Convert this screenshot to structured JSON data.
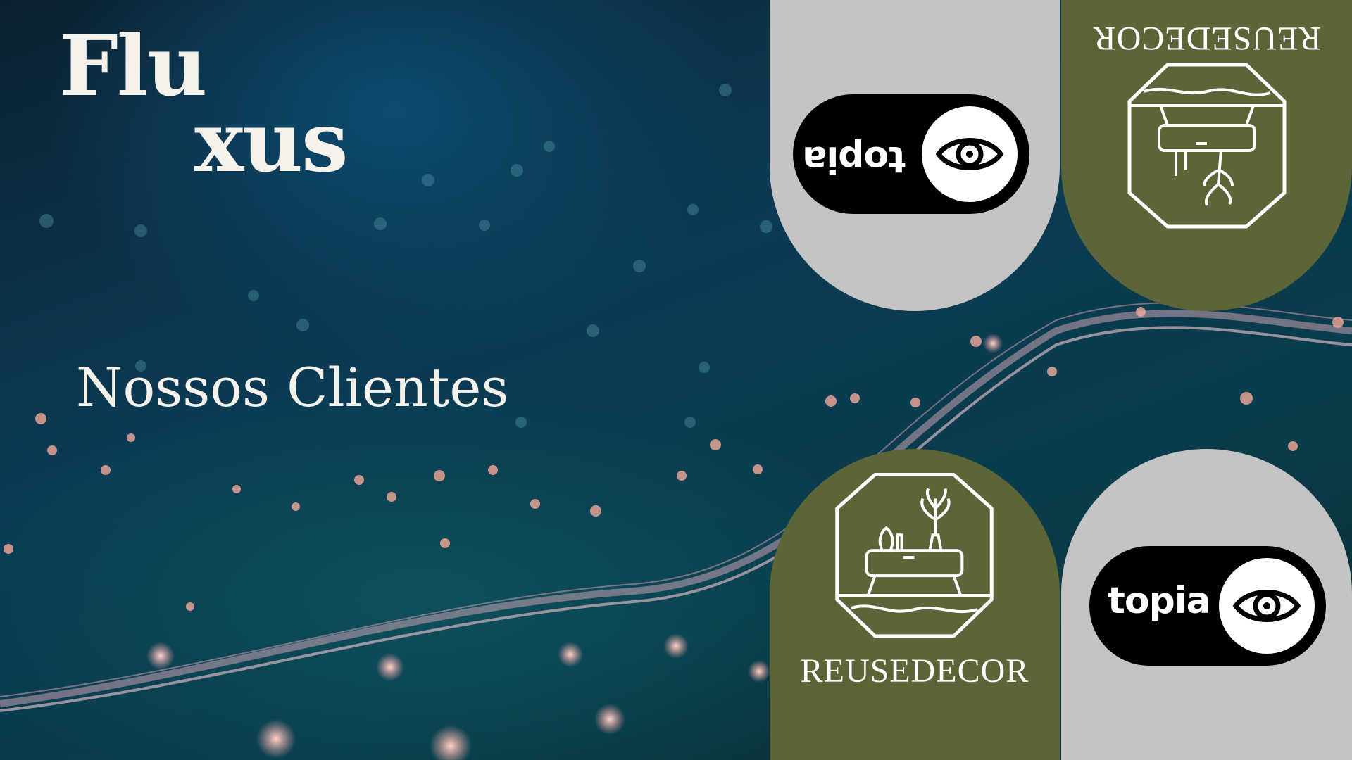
{
  "brand": {
    "line1": "Flu",
    "line2": "xus"
  },
  "subtitle": "Nossos Clientes",
  "clients": [
    {
      "logo": "topia",
      "text": "topia",
      "orientation": "upside-down",
      "background": "#c4c4c4"
    },
    {
      "logo": "reusedecor",
      "text": "REUSEDECOR",
      "orientation": "upside-down",
      "background": "#5b6538"
    },
    {
      "logo": "reusedecor",
      "text": "REUSEDECOR",
      "orientation": "upright",
      "background": "#5b6538"
    },
    {
      "logo": "topia",
      "text": "topia",
      "orientation": "upright",
      "background": "#c4c4c4"
    }
  ],
  "colors": {
    "olive": "#5b6538",
    "grey": "#c4c4c4",
    "text": "#f4f2ea"
  },
  "icons": [
    "eye-icon",
    "table-plant-icon",
    "hexagon-frame-icon"
  ]
}
